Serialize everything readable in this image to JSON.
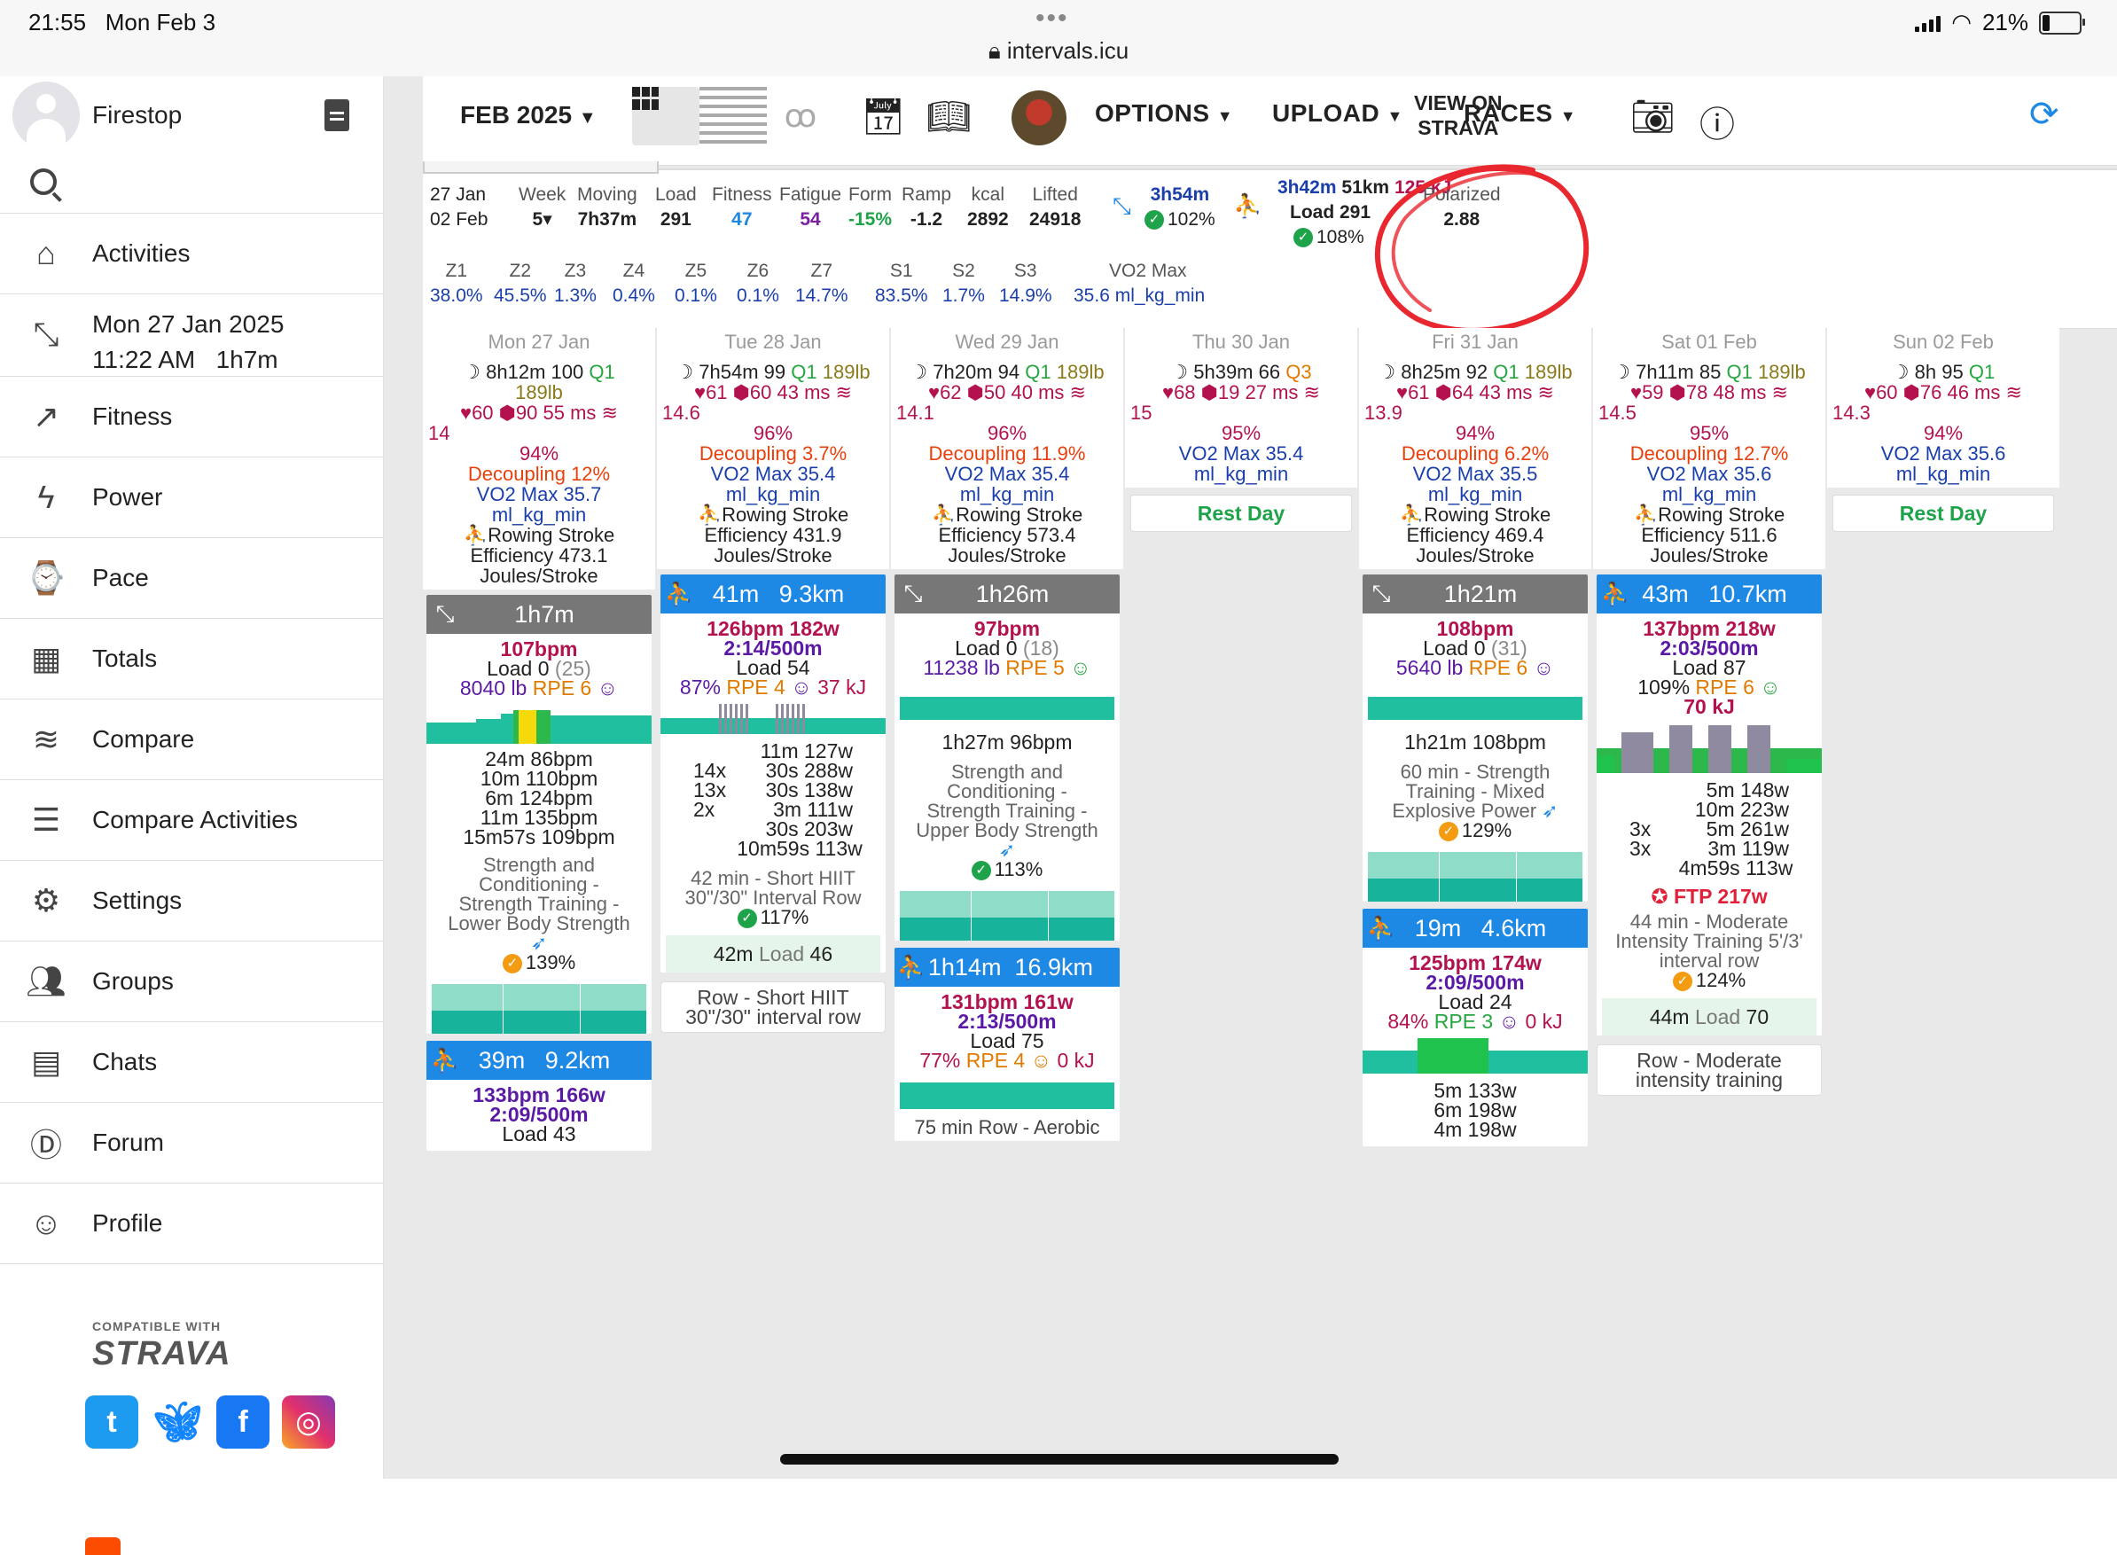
{
  "status": {
    "time": "21:55",
    "date": "Mon Feb 3",
    "url": "intervals.icu",
    "battery": "21%"
  },
  "sidebar": {
    "user": "Firestop",
    "items": [
      {
        "label": "Activities",
        "icon": "home-icon"
      },
      {
        "label": "Mon 27 Jan 2025",
        "sub": "11:22 AM   1h7m",
        "icon": "activity-arrows-icon"
      },
      {
        "label": "Fitness",
        "icon": "trend-icon"
      },
      {
        "label": "Power",
        "icon": "lightning-icon"
      },
      {
        "label": "Pace",
        "icon": "watch-icon"
      },
      {
        "label": "Totals",
        "icon": "calendar-clock-icon"
      },
      {
        "label": "Compare",
        "icon": "compare-chart-icon"
      },
      {
        "label": "Compare Activities",
        "icon": "compare-list-icon"
      },
      {
        "label": "Settings",
        "icon": "gear-icon"
      },
      {
        "label": "Groups",
        "icon": "groups-icon"
      },
      {
        "label": "Chats",
        "icon": "chat-icon"
      },
      {
        "label": "Forum",
        "icon": "forum-icon"
      },
      {
        "label": "Profile",
        "icon": "profile-icon"
      }
    ],
    "compatible": "COMPATIBLE WITH",
    "strava": "STRAVA"
  },
  "toolbar": {
    "month": "FEB 2025",
    "options": "OPTIONS",
    "upload": "UPLOAD",
    "races": "RACES",
    "view_on_strava_1": "VIEW ON",
    "view_on_strava_2": "STRAVA"
  },
  "summary": {
    "dates1": "27 Jan",
    "dates2": "02 Feb",
    "week_h": "Week",
    "week_v": "5",
    "moving_h": "Moving",
    "moving_v": "7h37m",
    "load_h": "Load",
    "load_v": "291",
    "fitness_h": "Fitness",
    "fitness_v": "47",
    "fatigue_h": "Fatigue",
    "fatigue_v": "54",
    "form_h": "Form",
    "form_v": "-15%",
    "ramp_h": "Ramp",
    "ramp_v": "-1.2",
    "kcal_h": "kcal",
    "kcal_v": "2892",
    "lifted_h": "Lifted",
    "lifted_v": "24918",
    "strength_time": "3h54m",
    "strength_pct": "102%",
    "row_line1a": "3h42m",
    "row_line1b": "51km",
    "row_line1c": "125 kJ",
    "row_load": "Load 291",
    "row_pct": "108%",
    "polarized_h": "Polarized",
    "polarized_v": "2.88",
    "zones": [
      {
        "h": "Z1",
        "v": "38.0%"
      },
      {
        "h": "Z2",
        "v": "45.5%"
      },
      {
        "h": "Z3",
        "v": "1.3%"
      },
      {
        "h": "Z4",
        "v": "0.4%"
      },
      {
        "h": "Z5",
        "v": "0.1%"
      },
      {
        "h": "Z6",
        "v": "0.1%"
      },
      {
        "h": "Z7",
        "v": "14.7%"
      },
      {
        "h": "S1",
        "v": "83.5%"
      },
      {
        "h": "S2",
        "v": "1.7%"
      },
      {
        "h": "S3",
        "v": "14.9%"
      }
    ],
    "vo2_h": "VO2 Max",
    "vo2_v": "35.6 ml_kg_min"
  },
  "days": {
    "mon": {
      "hdr": "Mon 27 Jan",
      "sleep": "8h12m",
      "score": "100",
      "q": "Q1",
      "weight": "189lb",
      "hr": "60",
      "hrv": "90",
      "ms": "55 ms",
      "resp": "14",
      "pct": "94%",
      "dec": "Decoupling 12%",
      "vo2": "VO2 Max 35.7",
      "unit": "ml_kg_min",
      "eff1": "Rowing Stroke",
      "eff2": "Efficiency 473.1",
      "eff3": "Joules/Stroke"
    },
    "tue": {
      "hdr": "Tue 28 Jan",
      "sleep": "7h54m",
      "score": "99",
      "q": "Q1",
      "weight": "189lb",
      "hr": "61",
      "hrv": "60",
      "ms": "43 ms",
      "resp": "14.6",
      "pct": "96%",
      "dec": "Decoupling 3.7%",
      "vo2": "VO2 Max 35.4",
      "unit": "ml_kg_min",
      "eff1": "Rowing Stroke",
      "eff2": "Efficiency 431.9",
      "eff3": "Joules/Stroke"
    },
    "wed": {
      "hdr": "Wed 29 Jan",
      "sleep": "7h20m",
      "score": "94",
      "q": "Q1",
      "weight": "189lb",
      "hr": "62",
      "hrv": "50",
      "ms": "40 ms",
      "resp": "14.1",
      "pct": "96%",
      "dec": "Decoupling 11.9%",
      "vo2": "VO2 Max 35.4",
      "unit": "ml_kg_min",
      "eff1": "Rowing Stroke",
      "eff2": "Efficiency 573.4",
      "eff3": "Joules/Stroke"
    },
    "thu": {
      "hdr": "Thu 30 Jan",
      "sleep": "5h39m",
      "score": "66",
      "q": "Q3",
      "hr": "68",
      "hrv": "19",
      "ms": "27 ms",
      "resp": "15",
      "pct": "95%",
      "vo2": "VO2 Max 35.4",
      "unit": "ml_kg_min",
      "rest": "Rest Day"
    },
    "fri": {
      "hdr": "Fri 31 Jan",
      "sleep": "8h25m",
      "score": "92",
      "q": "Q1",
      "weight": "189lb",
      "hr": "61",
      "hrv": "64",
      "ms": "43 ms",
      "resp": "13.9",
      "pct": "94%",
      "dec": "Decoupling 6.2%",
      "vo2": "VO2 Max 35.5",
      "unit": "ml_kg_min",
      "eff1": "Rowing Stroke",
      "eff2": "Efficiency 469.4",
      "eff3": "Joules/Stroke"
    },
    "sat": {
      "hdr": "Sat 01 Feb",
      "sleep": "7h11m",
      "score": "85",
      "q": "Q1",
      "weight": "189lb",
      "hr": "59",
      "hrv": "78",
      "ms": "48 ms",
      "resp": "14.5",
      "pct": "95%",
      "dec": "Decoupling 12.7%",
      "vo2": "VO2 Max 35.6",
      "unit": "ml_kg_min",
      "eff1": "Rowing Stroke",
      "eff2": "Efficiency 511.6",
      "eff3": "Joules/Stroke"
    },
    "sun": {
      "hdr": "Sun 02 Feb",
      "sleep": "8h",
      "score": "95",
      "q": "Q1",
      "hr": "60",
      "hrv": "76",
      "ms": "46 ms",
      "resp": "14.3",
      "pct": "94%",
      "vo2": "VO2 Max 35.6",
      "unit": "ml_kg_min",
      "rest": "Rest Day"
    }
  },
  "acts": {
    "mon1": {
      "time": "1h7m",
      "bpm": "107bpm",
      "load": "Load 0",
      "load_x": "(25)",
      "lb": "8040 lb",
      "rpe": "RPE 6",
      "ints": [
        "24m 86bpm",
        "10m 110bpm",
        "6m 124bpm",
        "11m 135bpm",
        "15m57s 109bpm"
      ],
      "d1": "Strength and",
      "d2": "Conditioning -",
      "d3": "Strength Training -",
      "d4": "Lower Body Strength",
      "pct": "139%"
    },
    "mon2": {
      "time": "39m",
      "dist": "9.2km",
      "line1": "133bpm 166w",
      "line2": "2:09/500m",
      "line3": "Load 43"
    },
    "tue1": {
      "time": "41m",
      "dist": "9.3km",
      "line1": "126bpm 182w",
      "line2": "2:14/500m",
      "line3": "Load 54",
      "eff": "87%",
      "rpe": "RPE 4",
      "kj": "37 kJ",
      "ints": [
        [
          "",
          "11m 127w"
        ],
        [
          "14x",
          "30s 288w"
        ],
        [
          "13x",
          "30s 138w"
        ],
        [
          "2x",
          "3m 111w"
        ],
        [
          "",
          "30s 203w"
        ],
        [
          "",
          "10m59s 113w"
        ]
      ],
      "d1": "42 min - Short HIIT",
      "d2": "30\"/30\" Interval Row",
      "pct": "117%",
      "lc_time": "42m",
      "lc_load": "Load",
      "lc_val": "46",
      "note1": "Row - Short HIIT",
      "note2": "30\"/30\" interval row"
    },
    "wed1": {
      "time": "1h26m",
      "bpm": "97bpm",
      "load": "Load 0",
      "load_x": "(18)",
      "lb": "11238 lb",
      "rpe": "RPE 5",
      "int": "1h27m 96bpm",
      "d1": "Strength and",
      "d2": "Conditioning -",
      "d3": "Strength Training -",
      "d4": "Upper Body Strength",
      "pct": "113%"
    },
    "wed2": {
      "time": "1h14m",
      "dist": "16.9km",
      "line1": "131bpm 161w",
      "line2": "2:13/500m",
      "line3": "Load 75",
      "eff": "77%",
      "rpe": "RPE 4",
      "kj": "0 kJ",
      "d1": "75 min Row - Aerobic"
    },
    "fri1": {
      "time": "1h21m",
      "bpm": "108bpm",
      "load": "Load 0",
      "load_x": "(31)",
      "lb": "5640 lb",
      "rpe": "RPE 6",
      "int": "1h21m 108bpm",
      "d1": "60 min - Strength",
      "d2": "Training - Mixed",
      "d3": "Explosive Power",
      "pct": "129%"
    },
    "fri2": {
      "time": "19m",
      "dist": "4.6km",
      "line1": "125bpm 174w",
      "line2": "2:09/500m",
      "line3": "Load 24",
      "eff": "84%",
      "rpe": "RPE 3",
      "kj": "0 kJ",
      "ints": [
        "5m 133w",
        "6m 198w",
        "4m 198w"
      ]
    },
    "sat1": {
      "time": "43m",
      "dist": "10.7km",
      "line1": "137bpm 218w",
      "line2": "2:03/500m",
      "line3": "Load 87",
      "eff": "109%",
      "rpe": "RPE 6",
      "kj": "70 kJ",
      "ints": [
        [
          "",
          "5m 148w"
        ],
        [
          "",
          "10m 223w"
        ],
        [
          "3x",
          "5m 261w"
        ],
        [
          "3x",
          "3m 119w"
        ],
        [
          "",
          "4m59s 113w"
        ]
      ],
      "ftp": "FTP 217w",
      "d1": "44 min - Moderate",
      "d2": "Intensity Training 5'/3'",
      "d3": "interval row",
      "pct": "124%",
      "lc_time": "44m",
      "lc_load": "Load",
      "lc_val": "70",
      "note1": "Row - Moderate",
      "note2": "intensity training"
    }
  }
}
